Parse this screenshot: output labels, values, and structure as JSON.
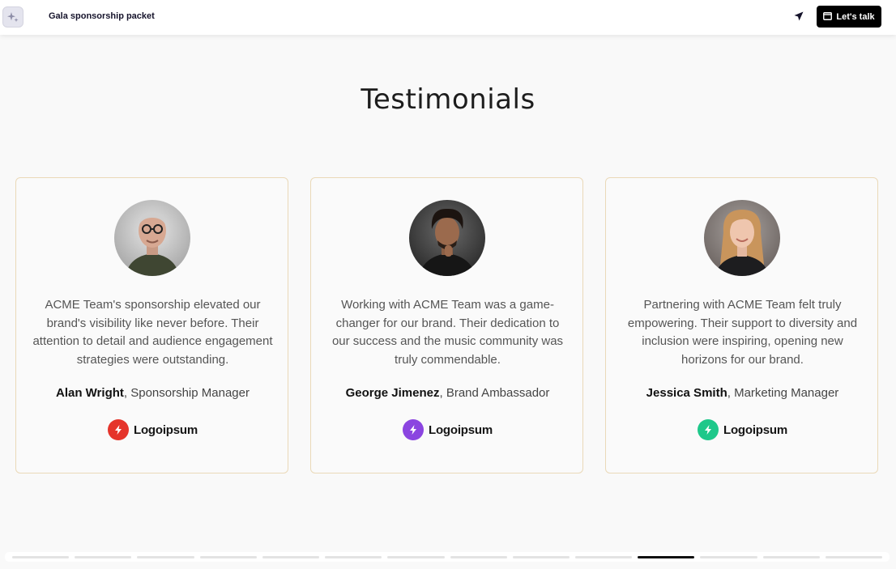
{
  "header": {
    "title": "Gala sponsorship packet",
    "cta_label": "Let's talk",
    "app_icon": "sparkle-icon",
    "share_icon": "send-arrow-icon",
    "calendar_icon": "calendar-icon"
  },
  "section": {
    "heading": "Testimonials"
  },
  "testimonials": [
    {
      "quote": "ACME Team's sponsorship elevated our brand's visibility like never before. Their attention to detail and audience engagement strategies were outstanding.",
      "name": "Alan Wright",
      "role": ", Sponsorship Manager",
      "logo_text": "Logoipsum",
      "logo_color": "#e5342b"
    },
    {
      "quote": "Working with ACME Team was a game-changer for our brand. Their dedication to our success and the music community was truly commendable.",
      "name": "George Jimenez",
      "role": ", Brand Ambassador",
      "logo_text": "Logoipsum",
      "logo_color": "#8b45e0"
    },
    {
      "quote": "Partnering with ACME Team felt truly empowering. Their support to diversity and inclusion were inspiring, opening new horizons for our brand.",
      "name": "Jessica Smith",
      "role": ", Marketing Manager",
      "logo_text": "Logoipsum",
      "logo_color": "#1ec88a"
    }
  ],
  "pager": {
    "total_slides": 14,
    "active_slide": 11
  },
  "colors": {
    "card_border": "#ead9b8",
    "cta_bg": "#000000"
  }
}
